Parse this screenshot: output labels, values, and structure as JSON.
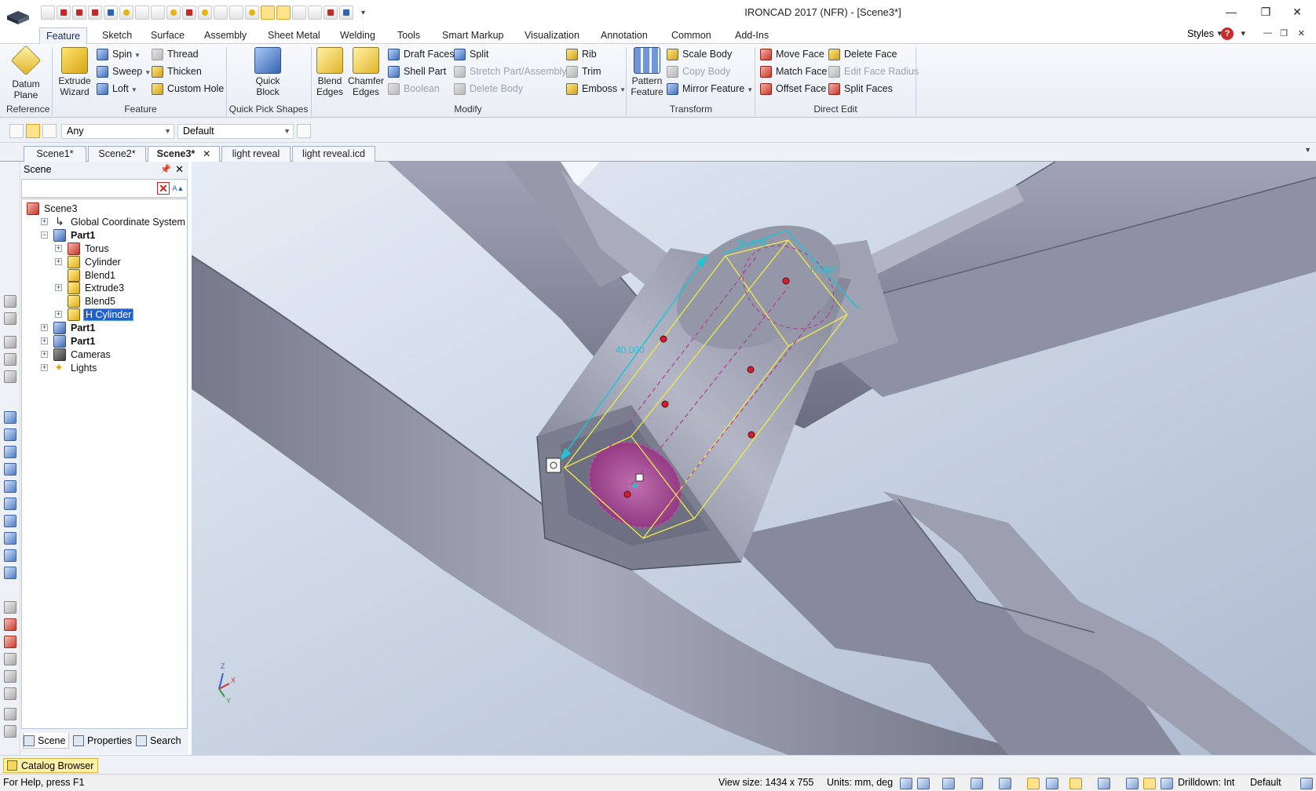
{
  "window": {
    "title": "IRONCAD 2017 (NFR) - [Scene3*]",
    "min": "—",
    "max": "❐",
    "close": "✕"
  },
  "ribbon_tabs": [
    "Feature",
    "Sketch",
    "Surface",
    "Assembly",
    "Sheet Metal",
    "Welding",
    "Tools",
    "Smart Markup",
    "Visualization",
    "Annotation",
    "Common",
    "Add-Ins"
  ],
  "ribbon_right": {
    "styles": "Styles",
    "help": "?"
  },
  "ribbon": {
    "reference": {
      "label": "Reference",
      "datum": "Datum\nPlane"
    },
    "feature": {
      "label": "Feature",
      "extrude": "Extrude\nWizard",
      "spin": "Spin",
      "sweep": "Sweep",
      "loft": "Loft",
      "thread": "Thread",
      "thicken": "Thicken",
      "custom_hole": "Custom Hole"
    },
    "quick_pick": {
      "label": "Quick Pick Shapes",
      "quick_block": "Quick\nBlock"
    },
    "modify": {
      "label": "Modify",
      "blend": "Blend\nEdges",
      "chamfer": "Chamfer\nEdges",
      "draft": "Draft Faces",
      "shell": "Shell Part",
      "boolean": "Boolean",
      "split": "Split",
      "stretch": "Stretch Part/Assembly",
      "delete_body": "Delete Body",
      "rib": "Rib",
      "trim": "Trim",
      "emboss": "Emboss"
    },
    "transform": {
      "label": "Transform",
      "pattern": "Pattern\nFeature",
      "scale": "Scale Body",
      "copy": "Copy Body",
      "mirror": "Mirror Feature"
    },
    "direct_edit": {
      "label": "Direct Edit",
      "move_face": "Move Face",
      "match_face": "Match Face",
      "offset_face": "Offset Face",
      "delete_face": "Delete Face",
      "edit_radius": "Edit Face Radius",
      "split_faces": "Split Faces"
    }
  },
  "selection_bar": {
    "filter": "Any",
    "style": "Default"
  },
  "doc_tabs": [
    {
      "label": "Scene1*"
    },
    {
      "label": "Scene2*"
    },
    {
      "label": "Scene3*",
      "close": "✕"
    },
    {
      "label": "light reveal"
    },
    {
      "label": "light reveal.icd"
    }
  ],
  "scene_panel": {
    "title": "Scene",
    "pin": "📌",
    "close": "✕",
    "tree": [
      {
        "label": "Scene3",
        "level": 0,
        "icon": "red",
        "expander": ""
      },
      {
        "label": "Global Coordinate System",
        "level": 1,
        "icon": "axis",
        "expander": "+"
      },
      {
        "label": "Part1",
        "level": 1,
        "icon": "part",
        "expander": "−",
        "bold": true
      },
      {
        "label": "Torus",
        "level": 2,
        "icon": "red",
        "expander": "+"
      },
      {
        "label": "Cylinder",
        "level": 2,
        "icon": "gold",
        "expander": "+"
      },
      {
        "label": "Blend1",
        "level": 2,
        "icon": "gold",
        "expander": ""
      },
      {
        "label": "Extrude3",
        "level": 2,
        "icon": "gold",
        "expander": "+"
      },
      {
        "label": "Blend5",
        "level": 2,
        "icon": "gold",
        "expander": ""
      },
      {
        "label": "H Cylinder",
        "level": 2,
        "icon": "gold",
        "expander": "+",
        "selected": true
      },
      {
        "label": "Part1",
        "level": 1,
        "icon": "part",
        "expander": "+",
        "bold": true
      },
      {
        "label": "Part1",
        "level": 1,
        "icon": "part",
        "expander": "+",
        "bold": true
      },
      {
        "label": "Cameras",
        "level": 1,
        "icon": "cam",
        "expander": "+"
      },
      {
        "label": "Lights",
        "level": 1,
        "icon": "light",
        "expander": "+"
      }
    ],
    "tabs": {
      "scene": "Scene",
      "properties": "Properties",
      "search": "Search"
    }
  },
  "viewport": {
    "dim_width": "15.000",
    "dim_height": "15.000",
    "dim_length": "40.000",
    "axis_z": "Z",
    "axis_x": "X",
    "axis_y": "Y"
  },
  "catalog": {
    "label": "Catalog Browser"
  },
  "status": {
    "help": "For Help, press F1",
    "view_size": "View size: 1434 x  755",
    "units": "Units: mm, deg",
    "drilldown": "Drilldown: Int",
    "default": "Default"
  },
  "colors": {
    "accent": "#1e62d2",
    "dimension": "#21c3d6",
    "handle_box": "#f2ea4a",
    "cylinder_face": "#b24a9a"
  }
}
